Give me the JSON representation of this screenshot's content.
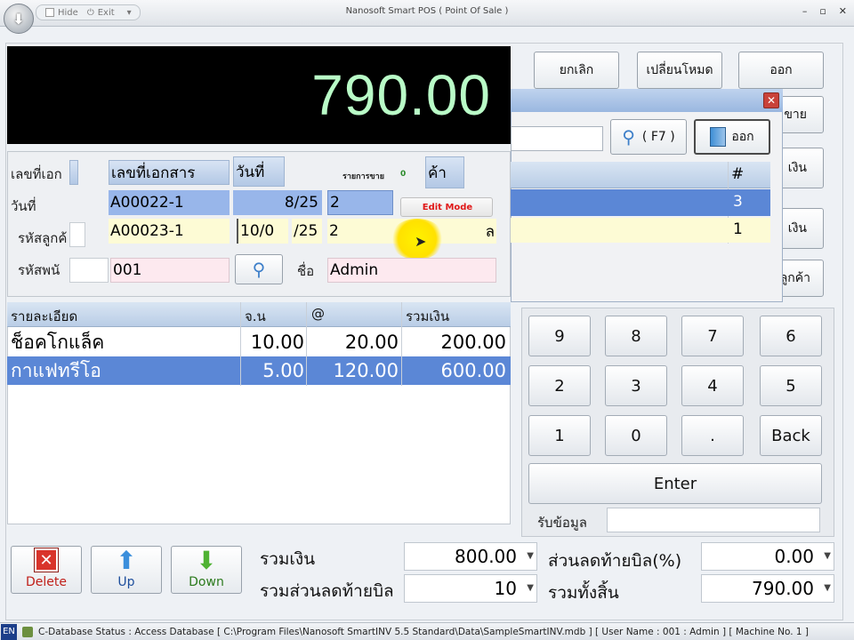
{
  "window": {
    "title": "Nanosoft Smart POS  ( Point Of Sale )",
    "qat_hide": "Hide",
    "qat_exit": "Exit"
  },
  "display": {
    "total": "790.00"
  },
  "top_buttons": {
    "cancel": "ยกเลิก",
    "change_mode": "เปลี่ยนโหมด",
    "exit": "ออก",
    "partial_1": "ขาย",
    "partial_2": "เงิน",
    "partial_3": "เงิน",
    "partial_4": "ลูกค้า"
  },
  "popup": {
    "f7_label": "( F7 )",
    "exit_label": "ออก",
    "col_hash": "#",
    "row1_num": "3",
    "row2_num": "1"
  },
  "form": {
    "doc_no_label": "เลขที่เอก",
    "date_label": "วันที่",
    "customer_label": "รหัสลูกค้",
    "employee_label": "รหัสพนั",
    "doc_no_header": "เลขที่เอกสาร",
    "date_header": "วันที่",
    "sale_items_label": "รายการขาย",
    "sale_items_count": "0",
    "customer_header": "ค้า",
    "row1_doc": "A00022-1",
    "row1_date": "8/25",
    "row1_extra": "2",
    "edit_mode": "Edit Mode",
    "row2_doc": "A00023-1",
    "row2_date": "10/0",
    "row2_date2": "/25",
    "row2_extra": "2",
    "row2_tail": "ล",
    "employee_code": "001",
    "name_label": "ชื่อ",
    "name_value": "Admin"
  },
  "grid": {
    "headers": [
      "รายละเอียด",
      "จ.น",
      "@",
      "รวมเงิน"
    ],
    "rows": [
      {
        "name": "ช็อคโกแล็ค",
        "qty": "10.00",
        "price": "20.00",
        "total": "200.00"
      },
      {
        "name": "กาแฟทรีโอ",
        "qty": "5.00",
        "price": "120.00",
        "total": "600.00"
      }
    ]
  },
  "keypad": {
    "keys": [
      "9",
      "8",
      "7",
      "6",
      "2",
      "3",
      "4",
      "5",
      "1",
      "0",
      ".",
      "Back"
    ],
    "enter": "Enter",
    "input_label": "รับข้อมูล"
  },
  "actions": {
    "delete": "Delete",
    "up": "Up",
    "down": "Down"
  },
  "summary": {
    "subtotal_label": "รวมเงิน",
    "subtotal_value": "800.00",
    "bill_discount_pct_label": "ส่วนลดท้ายบิล(%)",
    "bill_discount_pct_value": "0.00",
    "bill_discount_label": "รวมส่วนลดท้ายบิล",
    "bill_discount_value": "10",
    "grand_total_label": "รวมทั้งสิ้น",
    "grand_total_value": "790.00"
  },
  "status": {
    "lang": "EN",
    "text": "C-Database Status : Access Database [ C:\\Program Files\\Nanosoft SmartINV 5.5 Standard\\Data\\SampleSmartINV.mdb ]  [ User Name : 001 : Admin ] [ Machine No. 1 ]"
  },
  "colors": {
    "display_bg": "#000000",
    "display_fg": "#b9fbc7",
    "selection": "#5b87d6",
    "delete_red": "#d9342b",
    "up_blue": "#3b8fdc",
    "down_green": "#4fb233"
  }
}
